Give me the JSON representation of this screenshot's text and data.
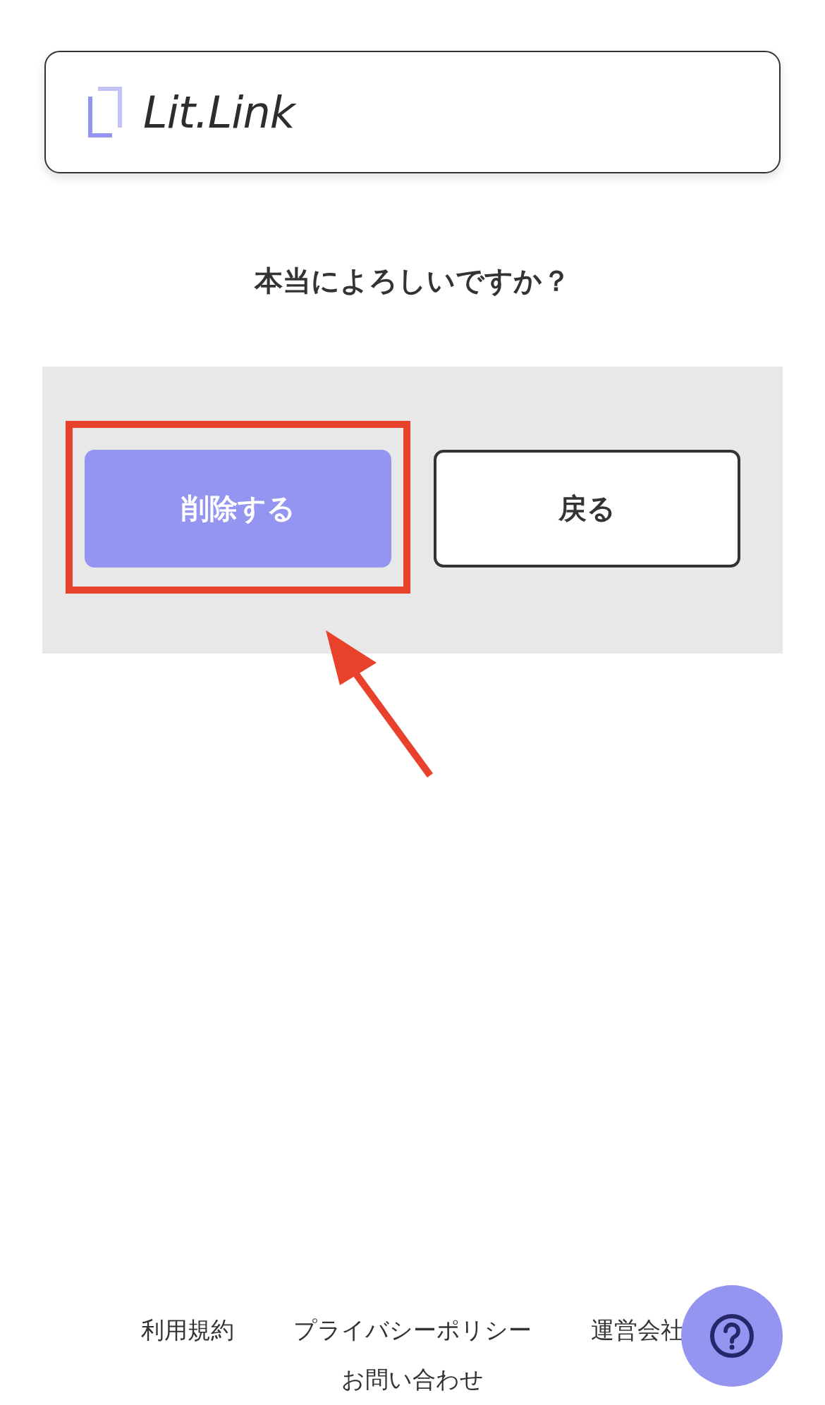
{
  "header": {
    "logo_text": "Lit.Link"
  },
  "title": "本当によろしいですか？",
  "buttons": [
    {
      "label": "削除する",
      "kind": "primary",
      "highlighted": true
    },
    {
      "label": "戻る",
      "kind": "secondary",
      "highlighted": false
    }
  ],
  "footer": {
    "links": [
      "利用規約",
      "プライバシーポリシー",
      "運営会社",
      "お問い合わせ"
    ]
  }
}
